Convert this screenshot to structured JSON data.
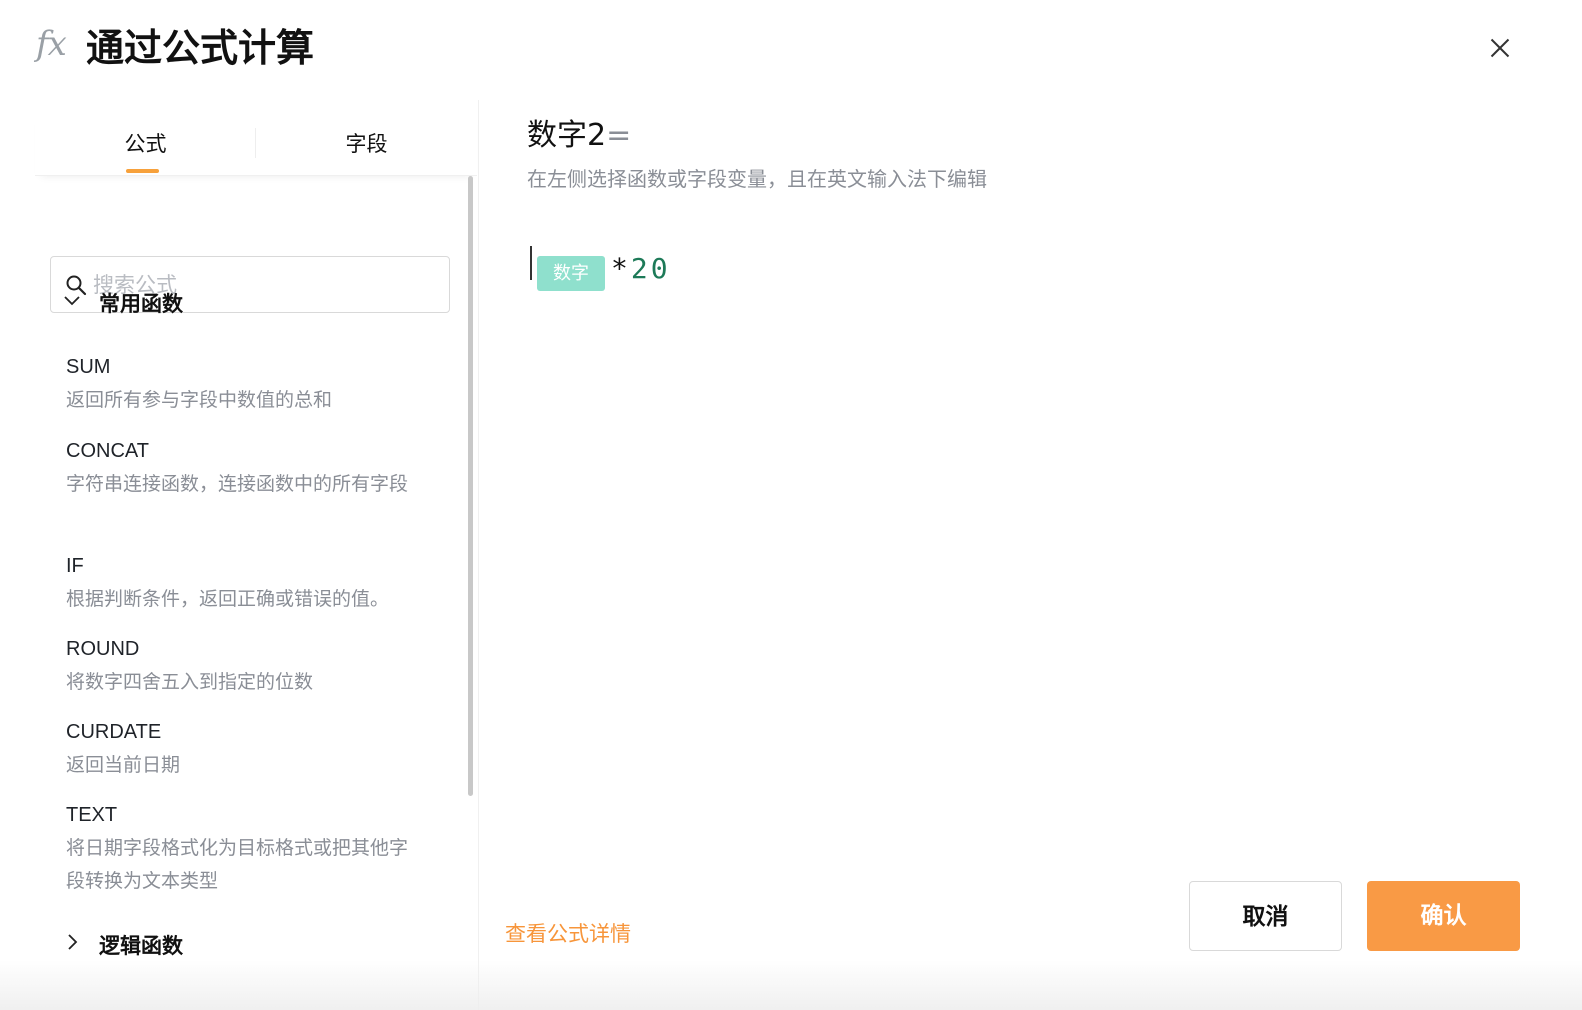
{
  "header": {
    "icon_text": "fx",
    "title": "通过公式计算"
  },
  "left": {
    "tabs": [
      {
        "label": "公式",
        "active": true
      },
      {
        "label": "字段",
        "active": false
      }
    ],
    "search": {
      "placeholder": "搜索公式",
      "value": ""
    },
    "groups": [
      {
        "label": "常用函数",
        "expanded": true,
        "items": [
          {
            "name": "SUM",
            "desc": "返回所有参与字段中数值的总和"
          },
          {
            "name": "CONCAT",
            "desc": "字符串连接函数，连接函数中的所有字段"
          },
          {
            "name": "IF",
            "desc": "根据判断条件，返回正确或错误的值。"
          },
          {
            "name": "ROUND",
            "desc": "将数字四舍五入到指定的位数"
          },
          {
            "name": "CURDATE",
            "desc": "返回当前日期"
          },
          {
            "name": "TEXT",
            "desc": "将日期字段格式化为目标格式或把其他字段转换为文本类型"
          }
        ]
      },
      {
        "label": "逻辑函数",
        "expanded": false,
        "items": []
      }
    ]
  },
  "editor": {
    "target_field": "数字2",
    "equals": "=",
    "hint": "在左侧选择函数或字段变量，且在英文输入法下编辑",
    "formula": {
      "field_tag": "数字",
      "operator": "*",
      "number": "20"
    }
  },
  "footer": {
    "detail_link": "查看公式详情",
    "cancel_label": "取消",
    "confirm_label": "确认"
  },
  "colors": {
    "accent": "#f99a45",
    "tab_underline": "#f7a13b",
    "field_tag_bg": "#8fe0cd",
    "number_color": "#1d7a58"
  }
}
